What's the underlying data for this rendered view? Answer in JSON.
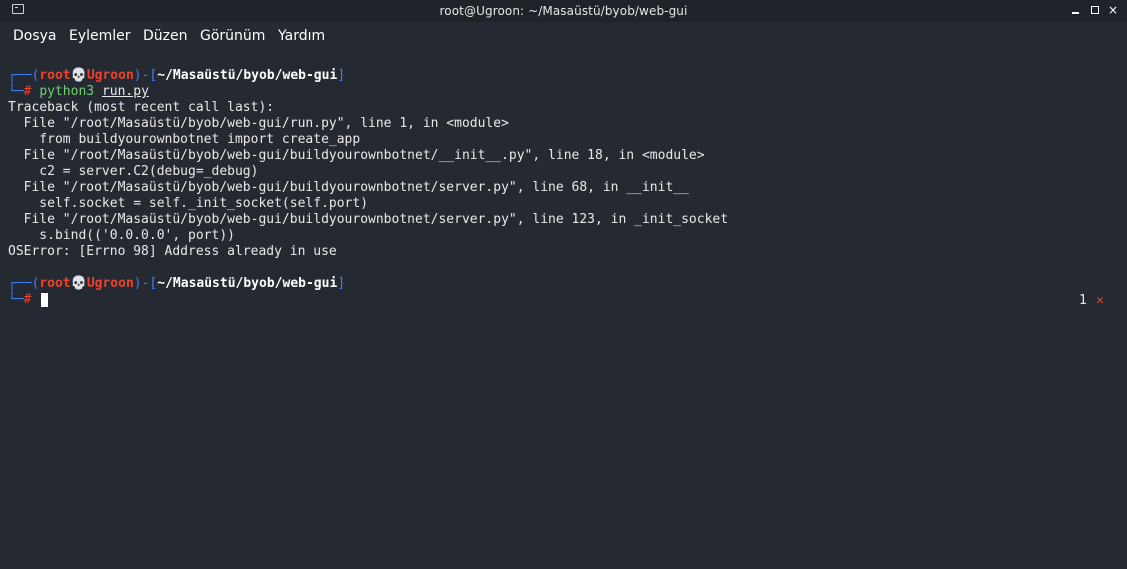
{
  "window": {
    "title": "root@Ugroon: ~/Masaüstü/byob/web-gui",
    "app_icon": "terminal-icon",
    "buttons": {
      "minimize": "minimize-icon",
      "maximize": "maximize-icon",
      "close": "×"
    }
  },
  "menu": {
    "items": [
      "Dosya",
      "Eylemler",
      "Düzen",
      "Görünüm",
      "Yardım"
    ]
  },
  "terminal": {
    "prompt1": {
      "corner_top": "┌──(",
      "user": "root",
      "skull": "💀",
      "host": "Ugroon",
      "sep": ")-[",
      "path": "~/Masaüstü/byob/web-gui",
      "close": "]",
      "corner_bottom": "└─",
      "hash": "#",
      "command": "python3",
      "argument": "run.py"
    },
    "output": [
      "Traceback (most recent call last):",
      "  File \"/root/Masaüstü/byob/web-gui/run.py\", line 1, in <module>",
      "    from buildyourownbotnet import create_app",
      "  File \"/root/Masaüstü/byob/web-gui/buildyourownbotnet/__init__.py\", line 18, in <module>",
      "    c2 = server.C2(debug=_debug)",
      "  File \"/root/Masaüstü/byob/web-gui/buildyourownbotnet/server.py\", line 68, in __init__",
      "    self.socket = self._init_socket(self.port)",
      "  File \"/root/Masaüstü/byob/web-gui/buildyourownbotnet/server.py\", line 123, in _init_socket",
      "    s.bind(('0.0.0.0', port))",
      "OSError: [Errno 98] Address already in use"
    ],
    "prompt2": {
      "corner_top": "┌──(",
      "user": "root",
      "skull": "💀",
      "host": "Ugroon",
      "sep": ")-[",
      "path": "~/Masaüstü/byob/web-gui",
      "close": "]",
      "corner_bottom": "└─",
      "hash": "#"
    },
    "status": {
      "count": "1",
      "error_mark": "✕"
    }
  }
}
